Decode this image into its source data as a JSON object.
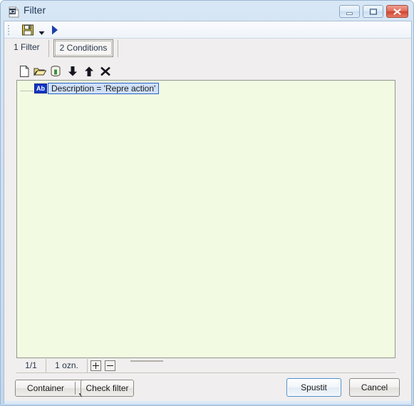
{
  "window": {
    "title": "Filter",
    "app_icon": "k2-document-icon",
    "caption_buttons": {
      "minimize": "minimize-icon",
      "maximize": "maximize-icon",
      "close": "close-icon"
    }
  },
  "toolbar": {
    "save_icon": "save-floppy-icon",
    "save_dropdown_icon": "chevron-down-icon",
    "run_icon": "run-play-icon"
  },
  "tabs": {
    "filter_label": "1 Filter",
    "conditions_label": "2 Conditions"
  },
  "inner_toolbar": {
    "new_icon": "new-document-icon",
    "open_icon": "open-folder-icon",
    "container_icon": "container-icon",
    "move_down_icon": "arrow-down-icon",
    "move_up_icon": "arrow-up-icon",
    "delete_icon": "delete-x-icon"
  },
  "tree": {
    "items": [
      {
        "icon_label": "Ab",
        "text": "Description = 'Repre action'",
        "selected": true
      }
    ]
  },
  "statusbar": {
    "page": "1/1",
    "selection": "1 ozn.",
    "expand_all": "plus-icon",
    "collapse_all": "minus-icon"
  },
  "buttons": {
    "container": "Container",
    "container_dropdown_icon": "chevron-down-icon",
    "check_filter": "Check filter",
    "run": "Spustit",
    "cancel": "Cancel"
  },
  "colors": {
    "titlebar_start": "#d8e7f5",
    "titlebar_end": "#c3d8ee",
    "tree_background": "#f2fbe2",
    "selection_background": "#cfe0f7",
    "selection_border": "#2a64c8",
    "ab_icon_background": "#1135c4",
    "close_button": "#cf4330",
    "default_button_border": "#4f8fc9"
  }
}
